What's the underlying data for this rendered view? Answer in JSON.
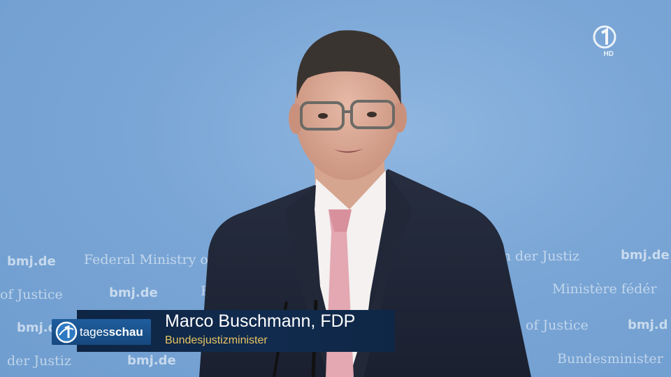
{
  "backdrop": {
    "texts": [
      "bmj.de",
      "Federal Ministry of",
      "m der Justiz",
      "bmj.de",
      "of Justice",
      "bmj.de",
      "B",
      "Ministère fédér",
      "bmj.d",
      "of Justice",
      "bmj.d",
      "der Justiz",
      "bmj.de",
      "Bundesminister"
    ]
  },
  "channel": {
    "logo_icon": "das-erste-one-icon",
    "hd_label": "HD"
  },
  "lower_third": {
    "brand_part1": "tages",
    "brand_part2": "schau",
    "name": "Marco Buschmann, FDP",
    "role": "Bundesjustizminister",
    "role_color": "#e9c462"
  }
}
